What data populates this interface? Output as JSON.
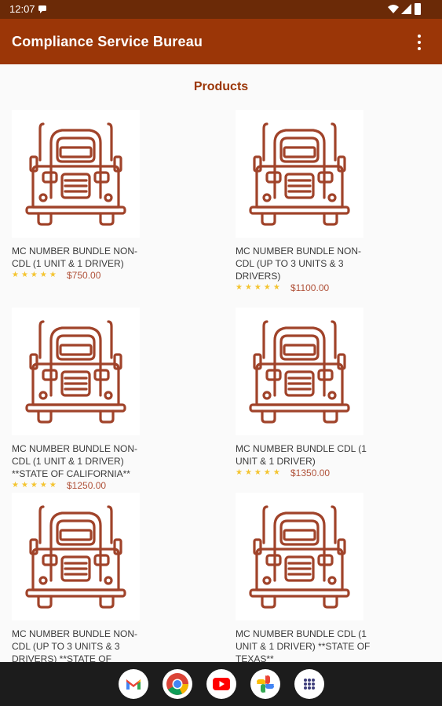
{
  "status_bar": {
    "time": "12:07"
  },
  "app_bar": {
    "title": "Compliance Service Bureau"
  },
  "page": {
    "section_title": "Products"
  },
  "products": [
    {
      "name": "MC NUMBER BUNDLE NON-CDL (1 UNIT & 1 DRIVER)",
      "rating": "★★★★★",
      "price": "$750.00"
    },
    {
      "name": "MC NUMBER BUNDLE NON-CDL (UP TO 3 UNITS & 3 DRIVERS)",
      "rating": "★★★★★",
      "price": "$1100.00"
    },
    {
      "name": "MC NUMBER BUNDLE NON-CDL (1 UNIT & 1 DRIVER) **STATE OF CALIFORNIA**",
      "rating": "★★★★★",
      "price": "$1250.00"
    },
    {
      "name": "MC NUMBER BUNDLE CDL (1 UNIT & 1 DRIVER)",
      "rating": "★★★★★",
      "price": "$1350.00"
    },
    {
      "name": "MC NUMBER BUNDLE NON-CDL (UP TO 3 UNITS & 3 DRIVERS) **STATE OF",
      "rating": "",
      "price": ""
    },
    {
      "name": "MC NUMBER BUNDLE CDL (1 UNIT & 1 DRIVER) **STATE OF TEXAS**",
      "rating": "",
      "price": ""
    }
  ],
  "icons": {
    "product_image": "truck-icon",
    "dock": [
      "gmail-icon",
      "chrome-icon",
      "youtube-icon",
      "photos-icon",
      "app-drawer-icon"
    ]
  },
  "colors": {
    "status_bar": "#6b2a07",
    "app_bar": "#9b3607",
    "accent": "#9b3607",
    "price": "#b0523a",
    "stars": "#f4c430",
    "truck": "#a0432a"
  }
}
